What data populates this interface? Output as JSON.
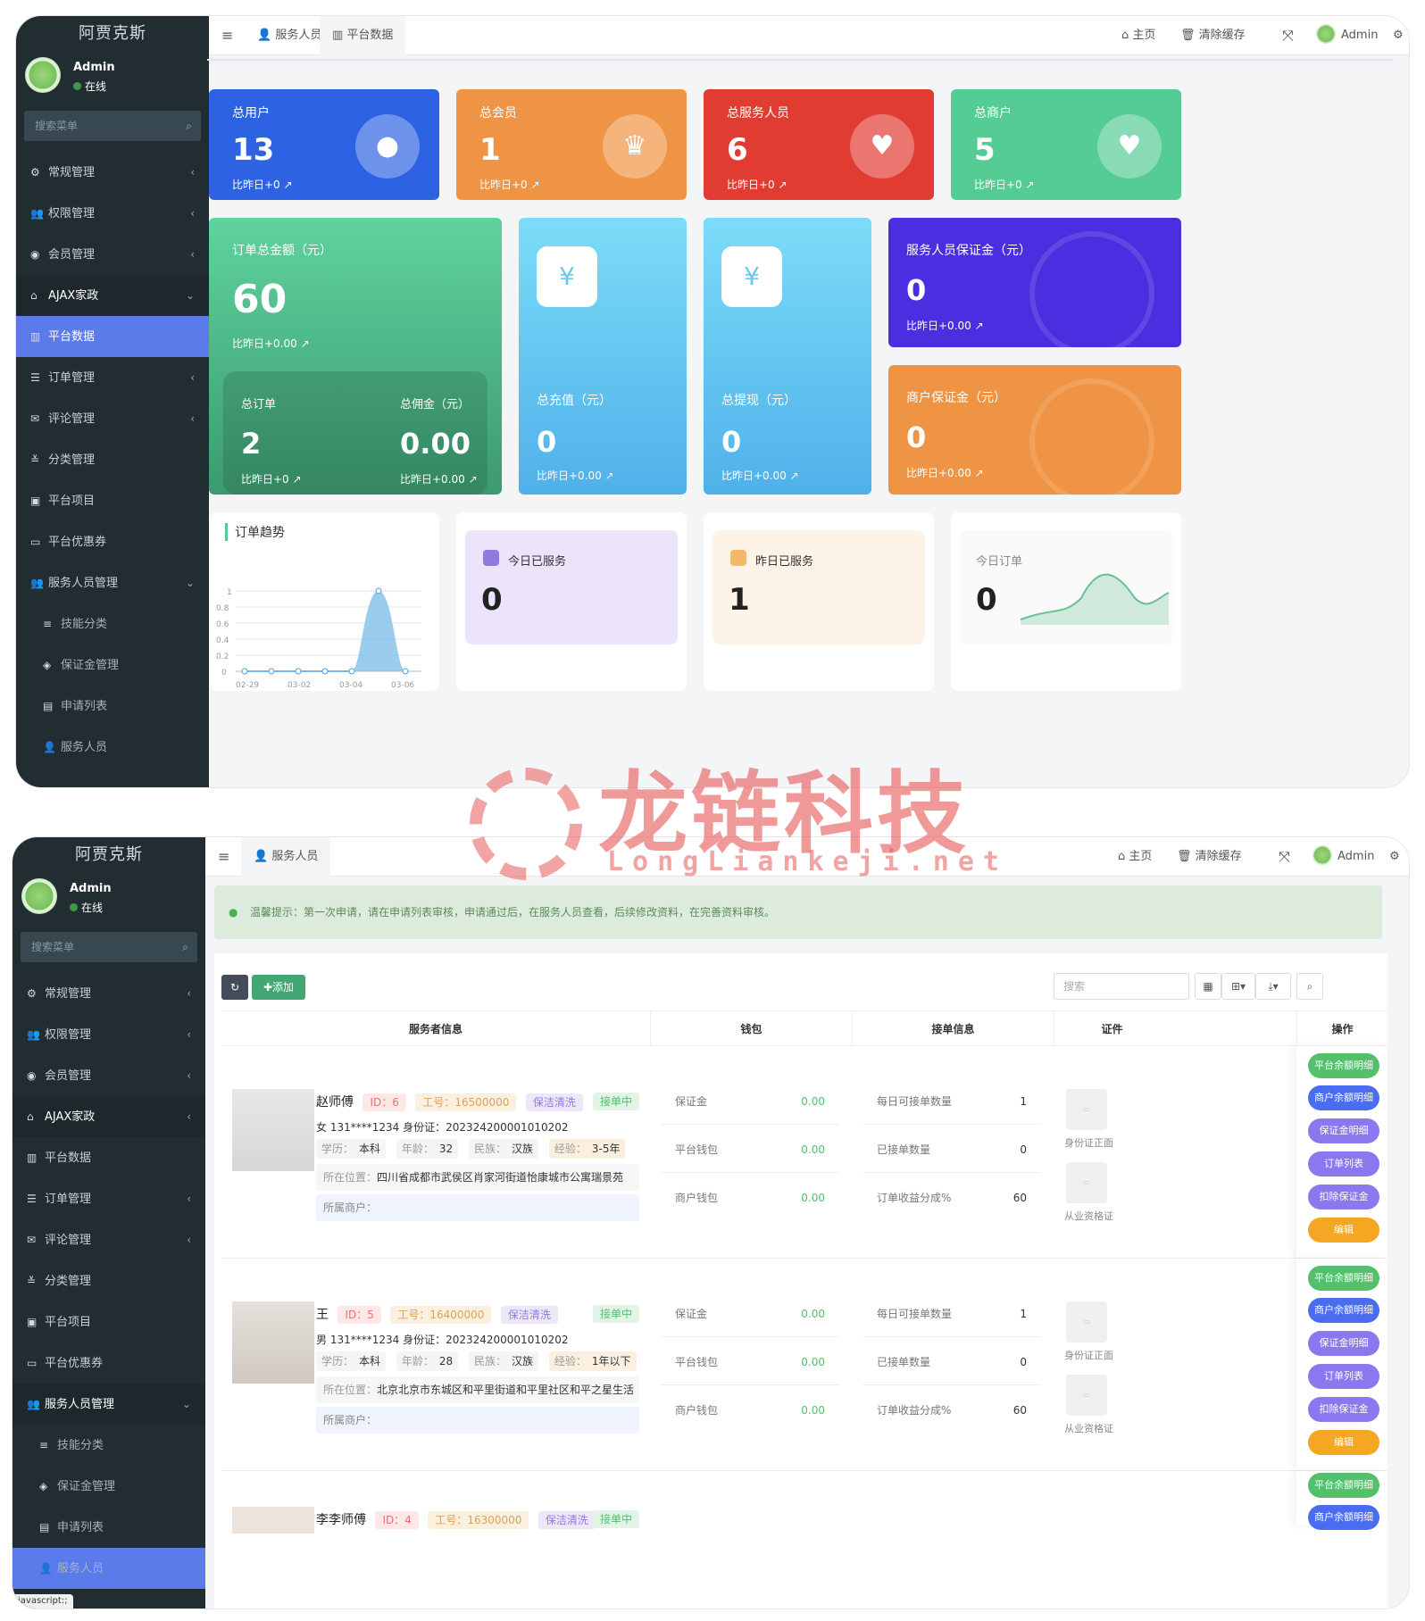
{
  "s1": {
    "brand": "阿贾克斯",
    "user": {
      "name": "Admin",
      "status": "在线"
    },
    "search_placeholder": "搜索菜单",
    "menu": [
      {
        "label": "常规管理",
        "icon": "gears-icon",
        "arrow": "‹"
      },
      {
        "label": "权限管理",
        "icon": "users-icon",
        "arrow": "‹"
      },
      {
        "label": "会员管理",
        "icon": "user-circle-icon",
        "arrow": "‹"
      },
      {
        "label": "AJAX家政",
        "icon": "home-icon",
        "arrow": "⌄"
      },
      {
        "label": "平台数据",
        "icon": "bar-chart-icon"
      },
      {
        "label": "订单管理",
        "icon": "list-icon",
        "arrow": "‹"
      },
      {
        "label": "评论管理",
        "icon": "comments-icon",
        "arrow": "‹"
      },
      {
        "label": "分类管理",
        "icon": "sliders-icon"
      },
      {
        "label": "平台项目",
        "icon": "briefcase-icon"
      },
      {
        "label": "平台优惠券",
        "icon": "credit-card-icon"
      },
      {
        "label": "服务人员管理",
        "icon": "users-icon",
        "arrow": "⌄"
      },
      {
        "label": "技能分类",
        "icon": "bars-icon"
      },
      {
        "label": "保证金管理",
        "icon": "shield-icon"
      },
      {
        "label": "申请列表",
        "icon": "id-card-icon"
      },
      {
        "label": "服务人员",
        "icon": "user-icon"
      }
    ],
    "topbar": {
      "tabs": [
        "服务人员",
        "平台数据"
      ],
      "home": "主页",
      "clear": "清除缓存",
      "admin": "Admin"
    },
    "stats": [
      {
        "label": "总用户",
        "value": "13",
        "compare": "比昨日+0",
        "color": "#2d63e2"
      },
      {
        "label": "总会员",
        "value": "1",
        "compare": "比昨日+0",
        "color": "#ef9444"
      },
      {
        "label": "总服务人员",
        "value": "6",
        "compare": "比昨日+0",
        "color": "#e13c32"
      },
      {
        "label": "总商户",
        "value": "5",
        "compare": "比昨日+0",
        "color": "#56cc95"
      }
    ],
    "order_total": {
      "label": "订单总金额（元）",
      "value": "60",
      "compare": "比昨日+0.00",
      "sub": [
        {
          "label": "总订单",
          "value": "2",
          "compare": "比昨日+0"
        },
        {
          "label": "总佣金（元）",
          "value": "0.00",
          "compare": "比昨日+0.00"
        }
      ]
    },
    "recharge": {
      "label": "总充值（元）",
      "value": "0",
      "compare": "比昨日+0.00"
    },
    "withdraw": {
      "label": "总提现（元）",
      "value": "0",
      "compare": "比昨日+0.00"
    },
    "deposit_staff": {
      "label": "服务人员保证金（元）",
      "value": "0",
      "compare": "比昨日+0.00"
    },
    "deposit_merchant": {
      "label": "商户保证金（元）",
      "value": "0",
      "compare": "比昨日+0.00"
    },
    "trend": {
      "title": "订单趋势",
      "yticks": [
        "1",
        "0.8",
        "0.6",
        "0.4",
        "0.2",
        "0"
      ],
      "xticks": [
        "02-29",
        "03-02",
        "03-04",
        "03-06"
      ]
    },
    "today_served": {
      "label": "今日已服务",
      "value": "0"
    },
    "yesterday_served": {
      "label": "昨日已服务",
      "value": "1"
    },
    "today_orders": {
      "label": "今日订单",
      "value": "0"
    }
  },
  "watermark": {
    "cn": "龙链科技",
    "en": "LongLiankeji.net"
  },
  "s2": {
    "topbar_tab": "服务人员",
    "tip": "温馨提示：第一次申请，请在申请列表审核，申请通过后，在服务人员查看，后续修改资料，在完善资料审核。",
    "add": "添加",
    "search_placeholder": "搜索",
    "columns": [
      "服务者信息",
      "钱包",
      "接单信息",
      "证件",
      "操作"
    ],
    "rows": [
      {
        "name": "赵师傅",
        "id": "ID：6",
        "no": "工号：16500000",
        "cat": "保洁清洗",
        "status": "接单中",
        "line2": "女  131****1234  身份证：202324200001010202",
        "edu": "本科",
        "age": "32",
        "nation": "汉族",
        "exp": "3-5年",
        "loc": "四川省成都市武侯区肖家河街道怡康城市公寓瑞景苑",
        "merchant": "所属商户："
      },
      {
        "name": "王",
        "id": "ID：5",
        "no": "工号：16400000",
        "cat": "保洁清洗",
        "status": "接单中",
        "line2": "男  131****1234  身份证：202324200001010202",
        "edu": "本科",
        "age": "28",
        "nation": "汉族",
        "exp": "1年以下",
        "loc": "北京北京市东城区和平里街道和平里社区和平之星生活广场",
        "merchant": "所属商户："
      },
      {
        "name": "李李师傅",
        "id": "ID：4",
        "no": "工号：16300000",
        "cat": "保洁清洗",
        "status": "接单中"
      }
    ],
    "wallet": [
      {
        "k": "保证金",
        "v": "0.00"
      },
      {
        "k": "平台钱包",
        "v": "0.00"
      },
      {
        "k": "商户钱包",
        "v": "0.00"
      }
    ],
    "orders": [
      {
        "k": "每日可接单数量",
        "v": "1"
      },
      {
        "k": "已接单数量",
        "v": "0"
      },
      {
        "k": "订单收益分成%",
        "v": "60"
      }
    ],
    "certs": [
      "身份证正面",
      "从业资格证"
    ],
    "ops": [
      "平台余额明细",
      "商户余额明细",
      "保证金明细",
      "订单列表",
      "扣除保证金",
      "编辑"
    ],
    "status_bar": "javascript:;",
    "labels": {
      "edu": "学历：",
      "age": "年龄：",
      "nation": "民族：",
      "exp": "经验：",
      "loc": "所在位置："
    }
  }
}
